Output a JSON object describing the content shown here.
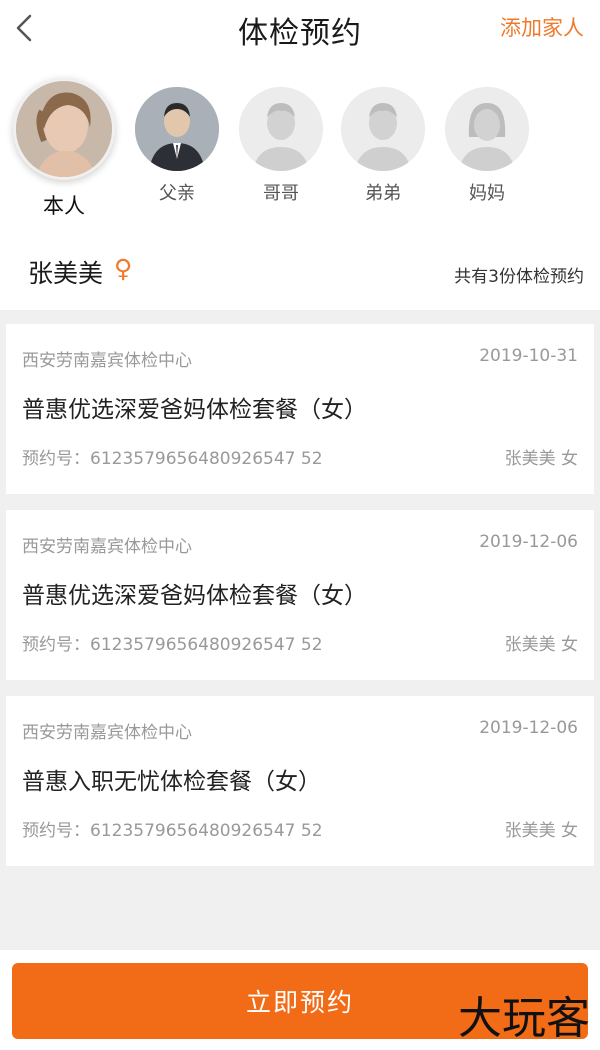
{
  "header": {
    "title": "体检预约",
    "add_member_label": "添加家人"
  },
  "members": [
    {
      "label": "本人",
      "selected": true
    },
    {
      "label": "父亲",
      "selected": false
    },
    {
      "label": "哥哥",
      "selected": false
    },
    {
      "label": "弟弟",
      "selected": false
    },
    {
      "label": "妈妈",
      "selected": false
    }
  ],
  "user": {
    "name": "张美美",
    "gender_symbol": "♀",
    "count_text": "共有3份体检预约"
  },
  "appointments": [
    {
      "center": "西安劳南嘉宾体检中心",
      "date": "2019-10-31",
      "package": "普惠优选深爱爸妈体检套餐（女）",
      "order_no": "预约号：6123579656480926547 52",
      "patient": "张美美 女"
    },
    {
      "center": "西安劳南嘉宾体检中心",
      "date": "2019-12-06",
      "package": "普惠优选深爱爸妈体检套餐（女）",
      "order_no": "预约号：6123579656480926547 52",
      "patient": "张美美 女"
    },
    {
      "center": "西安劳南嘉宾体检中心",
      "date": "2019-12-06",
      "package": "普惠入职无忧体检套餐（女）",
      "order_no": "预约号：6123579656480926547 52",
      "patient": "张美美 女"
    }
  ],
  "book_button_label": "立即预约",
  "watermark": "大玩客",
  "colors": {
    "accent": "#f07a2c",
    "button": "#f26c18",
    "background": "#f0f0f0"
  }
}
